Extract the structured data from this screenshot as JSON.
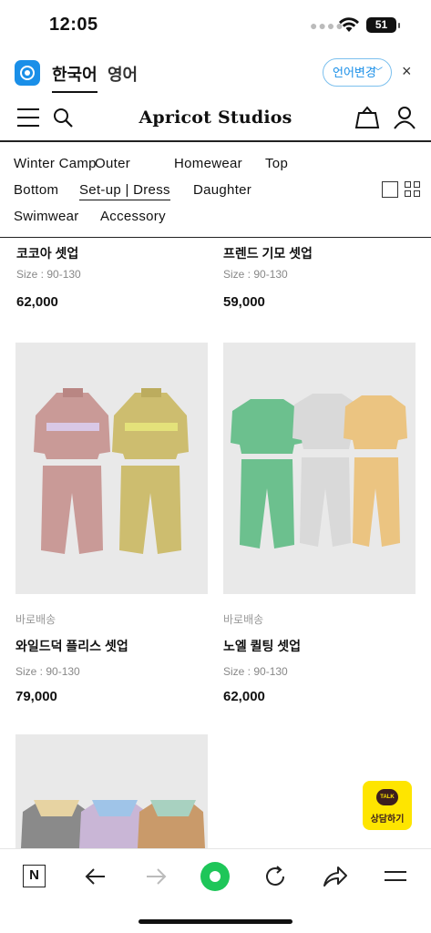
{
  "status_bar": {
    "time": "12:05",
    "battery": "51"
  },
  "language_bar": {
    "korean": "한국어",
    "english": "영어",
    "change_button": "언어변경",
    "close": "×"
  },
  "header": {
    "brand": "Apricot Studios"
  },
  "categories": [
    "Winter Camp",
    "Outer",
    "Homewear",
    "Top",
    "Bottom",
    "Set-up | Dress",
    "Daughter",
    "Swimwear",
    "Accessory"
  ],
  "active_category": "Set-up | Dress",
  "top_row": [
    {
      "name": "코코아 셋업",
      "size": "Size : 90-130",
      "price": "62,000"
    },
    {
      "name": "프렌드 기모 셋업",
      "size": "Size : 90-130",
      "price": "59,000"
    }
  ],
  "products": [
    {
      "shipping": "바로배송",
      "name": "와일드덕 플리스 셋업",
      "size": "Size : 90-130",
      "price": "79,000"
    },
    {
      "shipping": "바로배송",
      "name": "노엘 퀼팅 셋업",
      "size": "Size : 90-130",
      "price": "62,000"
    }
  ],
  "chat_button": {
    "badge": "TALK",
    "label": "상담하기"
  },
  "colors": {
    "accent_blue": "#1a8fe8",
    "kakao_yellow": "#fee500",
    "browser_green": "#1ec659"
  }
}
